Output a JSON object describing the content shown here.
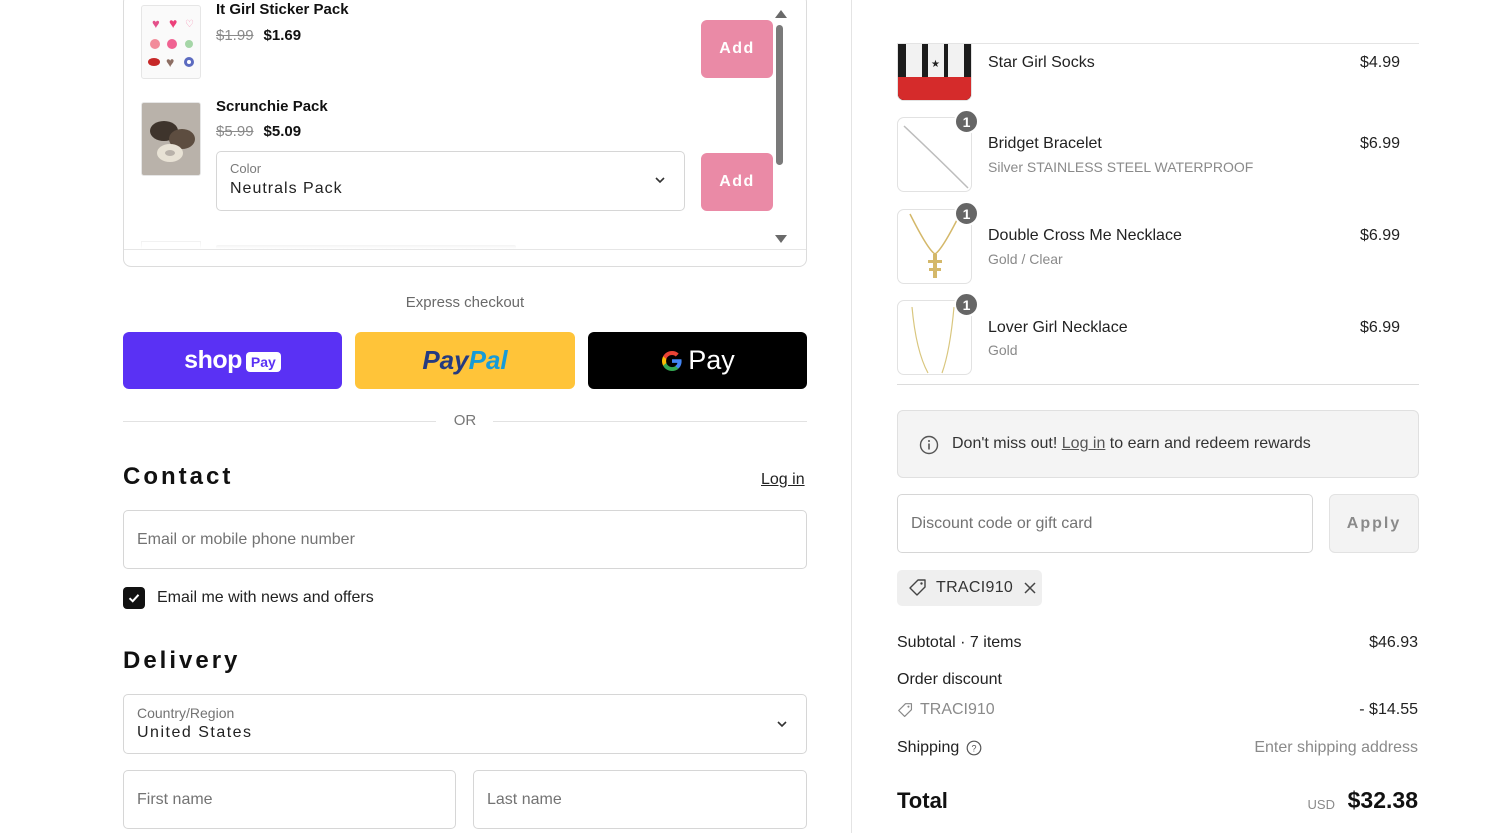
{
  "upsell": {
    "items": [
      {
        "name": "It Girl Sticker Pack",
        "old_price": "$1.99",
        "new_price": "$1.69",
        "add_label": "Add"
      },
      {
        "name": "Scrunchie Pack",
        "old_price": "$5.99",
        "new_price": "$5.09",
        "add_label": "Add",
        "select_label": "Color",
        "select_value": "Neutrals Pack"
      }
    ]
  },
  "express": {
    "title": "Express checkout",
    "shop_label": "shop",
    "shop_badge": "Pay",
    "paypal_label_a": "Pay",
    "paypal_label_b": "Pal",
    "gpay_label": "Pay",
    "or_label": "OR"
  },
  "contact": {
    "title": "Contact",
    "login_label": "Log in",
    "email_placeholder": "Email or mobile phone number",
    "newsletter_label": "Email me with news and offers",
    "newsletter_checked": true
  },
  "delivery": {
    "title": "Delivery",
    "country_label": "Country/Region",
    "country_value": "United States",
    "first_name_placeholder": "First name",
    "last_name_placeholder": "Last name"
  },
  "cart": {
    "lines": [
      {
        "name": "Star Girl Socks",
        "variant": "",
        "price": "$4.99",
        "qty": ""
      },
      {
        "name": "Bridget Bracelet",
        "variant": "Silver STAINLESS STEEL WATERPROOF",
        "price": "$6.99",
        "qty": "1"
      },
      {
        "name": "Double Cross Me Necklace",
        "variant": "Gold / Clear",
        "price": "$6.99",
        "qty": "1"
      },
      {
        "name": "Lover Girl Necklace",
        "variant": "Gold",
        "price": "$6.99",
        "qty": "1"
      }
    ]
  },
  "rewards": {
    "prefix": "Don't miss out! ",
    "link": "Log in",
    "suffix": " to earn and redeem rewards"
  },
  "discount": {
    "placeholder": "Discount code or gift card",
    "apply_label": "Apply",
    "applied_code": "TRACI910"
  },
  "summary": {
    "subtotal_label": "Subtotal · 7 items",
    "subtotal_value": "$46.93",
    "discount_label": "Order discount",
    "discount_code": "TRACI910",
    "discount_value": "- $14.55",
    "shipping_label": "Shipping",
    "shipping_value": "Enter shipping address",
    "total_label": "Total",
    "currency": "USD",
    "total_value": "$32.38"
  },
  "colors": {
    "add_button": "#ea8aa6",
    "shop_pay": "#5a31f4",
    "paypal": "#ffc439",
    "gpay": "#000000"
  }
}
